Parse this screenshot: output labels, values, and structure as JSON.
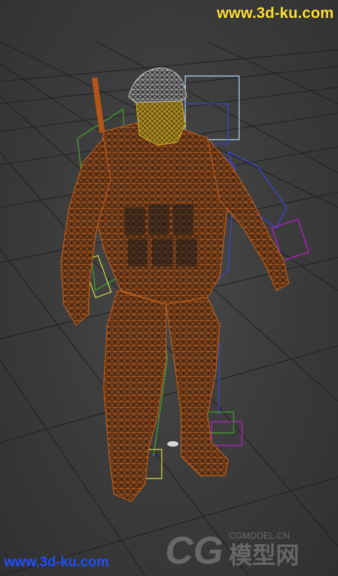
{
  "watermark": {
    "top_text": "www.3d-ku.com",
    "bottom_text": "www.3d-ku.com",
    "top_color": "#ffe135",
    "bottom_color": "#1f4fff"
  },
  "logo": {
    "mark": "CG",
    "domain": "CGMODEL.CN",
    "chinese": "模型网"
  },
  "colors": {
    "background": "#3b3b3b",
    "grid": "#1e1e1e",
    "mesh_wire": "#c2601c",
    "head_wire": "#e0b82a",
    "helmet_wire": "#cfcfcf",
    "bone_green": "#3fa62a",
    "bone_blue": "#3b46d6",
    "bone_cyan": "#9fd0ff",
    "bone_magenta": "#c020d0",
    "bone_yellow": "#d8e040"
  }
}
